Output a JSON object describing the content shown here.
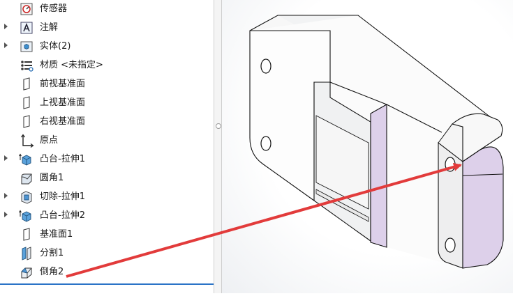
{
  "feature_tree": {
    "items": [
      {
        "label": "传感器",
        "icon": "sensor-icon",
        "expandable": false
      },
      {
        "label": "注解",
        "icon": "annotation-icon",
        "expandable": true
      },
      {
        "label": "实体(2)",
        "icon": "solid-bodies-icon",
        "expandable": true
      },
      {
        "label": "材质 <未指定>",
        "icon": "material-icon",
        "expandable": false
      },
      {
        "label": "前视基准面",
        "icon": "plane-icon",
        "expandable": false
      },
      {
        "label": "上视基准面",
        "icon": "plane-icon",
        "expandable": false
      },
      {
        "label": "右视基准面",
        "icon": "plane-icon",
        "expandable": false
      },
      {
        "label": "原点",
        "icon": "origin-icon",
        "expandable": false
      },
      {
        "label": "凸台-拉伸1",
        "icon": "boss-extrude-icon",
        "expandable": true
      },
      {
        "label": "圆角1",
        "icon": "fillet-icon",
        "expandable": false
      },
      {
        "label": "切除-拉伸1",
        "icon": "cut-extrude-icon",
        "expandable": true
      },
      {
        "label": "凸台-拉伸2",
        "icon": "boss-extrude-icon",
        "expandable": true
      },
      {
        "label": "基准面1",
        "icon": "plane-icon",
        "expandable": false
      },
      {
        "label": "分割1",
        "icon": "split-icon",
        "expandable": false
      },
      {
        "label": "倒角2",
        "icon": "chamfer-icon",
        "expandable": false
      }
    ]
  },
  "colors": {
    "selection_line": "#2b74c7",
    "arrow": "#e23b3b",
    "split_face": "#ddd0ea",
    "part_edge": "#1a1a1a"
  }
}
